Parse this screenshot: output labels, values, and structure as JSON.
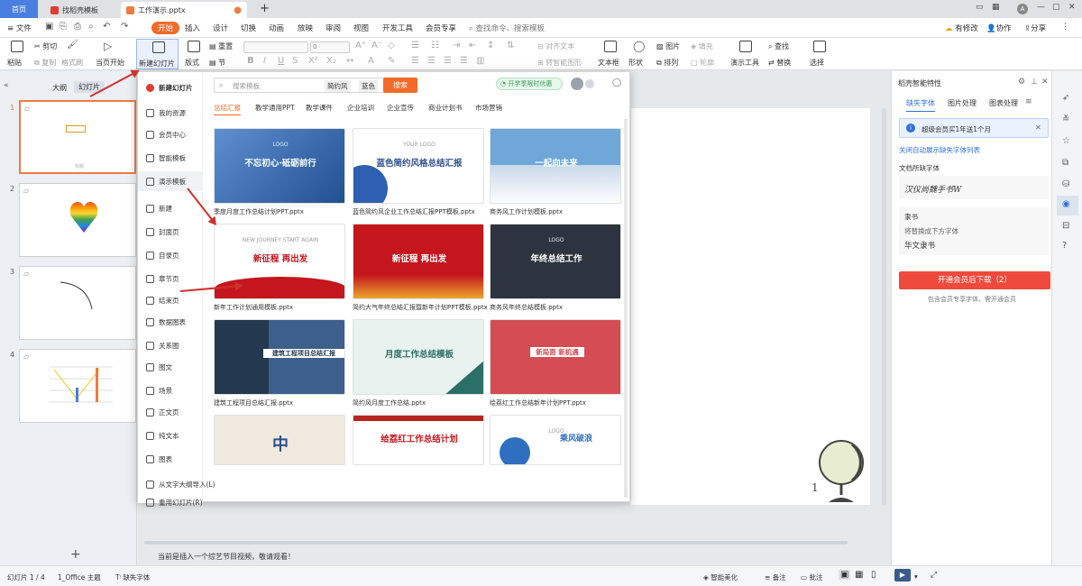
{
  "tabs": {
    "home": "首页",
    "t1": "找稻壳模板",
    "t2": "工作演示.pptx",
    "add": "+"
  },
  "window": {
    "badge": "A"
  },
  "menubar": {
    "file": "≡ 文件",
    "items": [
      "开始",
      "插入",
      "设计",
      "切换",
      "动画",
      "放映",
      "审阅",
      "视图",
      "开发工具",
      "会员专享"
    ],
    "search": "查找命令、搜索模板",
    "right": [
      "有修改",
      "协作",
      "分享"
    ]
  },
  "ribbon": {
    "paste": "粘贴",
    "cut": "剪切",
    "copy": "复制",
    "format_painter": "格式刷",
    "from_start": "当页开始",
    "new_slide": "新建幻灯片",
    "layout": "版式",
    "section": "节",
    "reset": "重置",
    "font_size": "0",
    "text_box": "文本框",
    "shape": "形状",
    "arrange": "排列",
    "picture": "图片",
    "fill": "填充",
    "outline": "轮廓",
    "present_tools": "演示工具",
    "find": "查找",
    "replace": "替换",
    "select": "选择",
    "align_text": "对齐文本",
    "convert_smartart": "转智能图形"
  },
  "leftpanel": {
    "tabs": [
      "大纲",
      "幻灯片"
    ],
    "slides": [
      "1",
      "2",
      "3",
      "4"
    ],
    "slide1_footer": "标题",
    "add": "+"
  },
  "dropdown": {
    "side": [
      {
        "label": "新建幻灯片",
        "icon": "wps-icon"
      },
      {
        "label": "我的资源",
        "icon": "resource-icon"
      },
      {
        "label": "会员中心",
        "icon": "member-icon"
      },
      {
        "label": "智能模板",
        "icon": "smart-template-icon"
      },
      {
        "label": "演示模板",
        "icon": "template-icon"
      },
      {
        "label": "新建",
        "icon": "new-icon"
      },
      {
        "label": "封面页",
        "icon": "cover-icon"
      },
      {
        "label": "目录页",
        "icon": "toc-icon"
      },
      {
        "label": "章节页",
        "icon": "chapter-icon"
      },
      {
        "label": "结束页",
        "icon": "end-icon"
      },
      {
        "label": "数据图表",
        "icon": "chart-icon"
      },
      {
        "label": "关系图",
        "icon": "relation-icon"
      },
      {
        "label": "图文",
        "icon": "image-text-icon"
      },
      {
        "label": "场景",
        "icon": "scene-icon"
      },
      {
        "label": "正文页",
        "icon": "body-icon"
      },
      {
        "label": "纯文本",
        "icon": "text-icon"
      },
      {
        "label": "图表",
        "icon": "graph-icon"
      }
    ],
    "bottom": [
      "从文字大纲导入(L)",
      "重用幻灯片(R)"
    ],
    "search_placeholder": "搜索模板",
    "chips": [
      "简约风",
      "蓝色"
    ],
    "search_button": "搜索",
    "promo": "开学季限时优惠",
    "categories": [
      "总结汇报",
      "教学通用PPT",
      "教学课件",
      "企业培训",
      "企业宣传",
      "商业计划书",
      "市场营销"
    ],
    "cards": [
      {
        "caption": "季度月度工作总结计划PPT.pptx",
        "headline": "不忘初心·砥砺前行",
        "sub": "LOGO",
        "bg": "#3c6fb0"
      },
      {
        "caption": "蓝色简约风企业工作总结汇报PPT模板.pptx",
        "headline": "蓝色简约风格总结汇报",
        "sub": "YOUR LOGO",
        "bg": "#ffffff"
      },
      {
        "caption": "商务风工作计划模板.pptx",
        "headline": "一起向未来",
        "sub": "",
        "bg": "#6ea7d8"
      },
      {
        "caption": "新年工作计划通用模板.pptx",
        "headline": "新征程 再出发",
        "sub": "NEW JOURNEY START AGAIN",
        "bg": "#ffffff"
      },
      {
        "caption": "简约大气年终总结汇报暨新年计划PPT模板.pptx",
        "headline": "新征程 再出发",
        "sub": "",
        "bg": "#c4161c"
      },
      {
        "caption": "商务风年终总结模板.pptx",
        "headline": "年终总结工作",
        "sub": "LOGO",
        "bg": "#2d3440"
      },
      {
        "caption": "建筑工程项目总结汇报.pptx",
        "headline": "建筑工程项目总结汇报",
        "sub": "",
        "bg": "#3d5f8c"
      },
      {
        "caption": "简约风月度工作总结.pptx",
        "headline": "月度工作总结模板",
        "sub": "",
        "bg": "#e8f2ee"
      },
      {
        "caption": "绘荔红工作总结新年计划PPT.pptx",
        "headline": "新局面 新机遇",
        "sub": "",
        "bg": "#d34d52"
      },
      {
        "caption": "",
        "headline": "中",
        "sub": "",
        "bg": "#efe9df"
      },
      {
        "caption": "",
        "headline": "给荔红工作总结计划",
        "sub": "",
        "bg": "#ffffff"
      },
      {
        "caption": "",
        "headline": "乘风破浪",
        "sub": "LOGO",
        "bg": "#ffffff"
      }
    ]
  },
  "rightpanel": {
    "title": "稻壳智能特性",
    "tabs": [
      "缺失字体",
      "图片处理",
      "图表处理"
    ],
    "notice": "超级会员买1年送1个月",
    "link": "关闭自动展示缺失字体列表",
    "section": "文档所缺字体",
    "font1_preview": "汉仪尚魏手书W",
    "font2_name": "隶书",
    "replace_hint": "将替换成下方字体",
    "font2_preview": "华文隶书",
    "download_btn": "开通会员后下载（2）",
    "footnote": "包含会员专享字体，需开通会员"
  },
  "slide": {
    "page_number": "1"
  },
  "canvas": {
    "notice": "当前是插入一个综艺节目视频，敬请观看！"
  },
  "statusbar": {
    "slide_count": "幻灯片 1 / 4",
    "theme": "1_Office 主题",
    "missing_font": "缺失字体",
    "smart_beautify": "智能美化",
    "notes": "备注",
    "comment": "批注",
    "zoom": "—"
  },
  "colors": {
    "accent": "#f26b2a",
    "brand_blue": "#4a7ee0",
    "annotation": "#d0312d",
    "download": "#ef4a3c"
  }
}
